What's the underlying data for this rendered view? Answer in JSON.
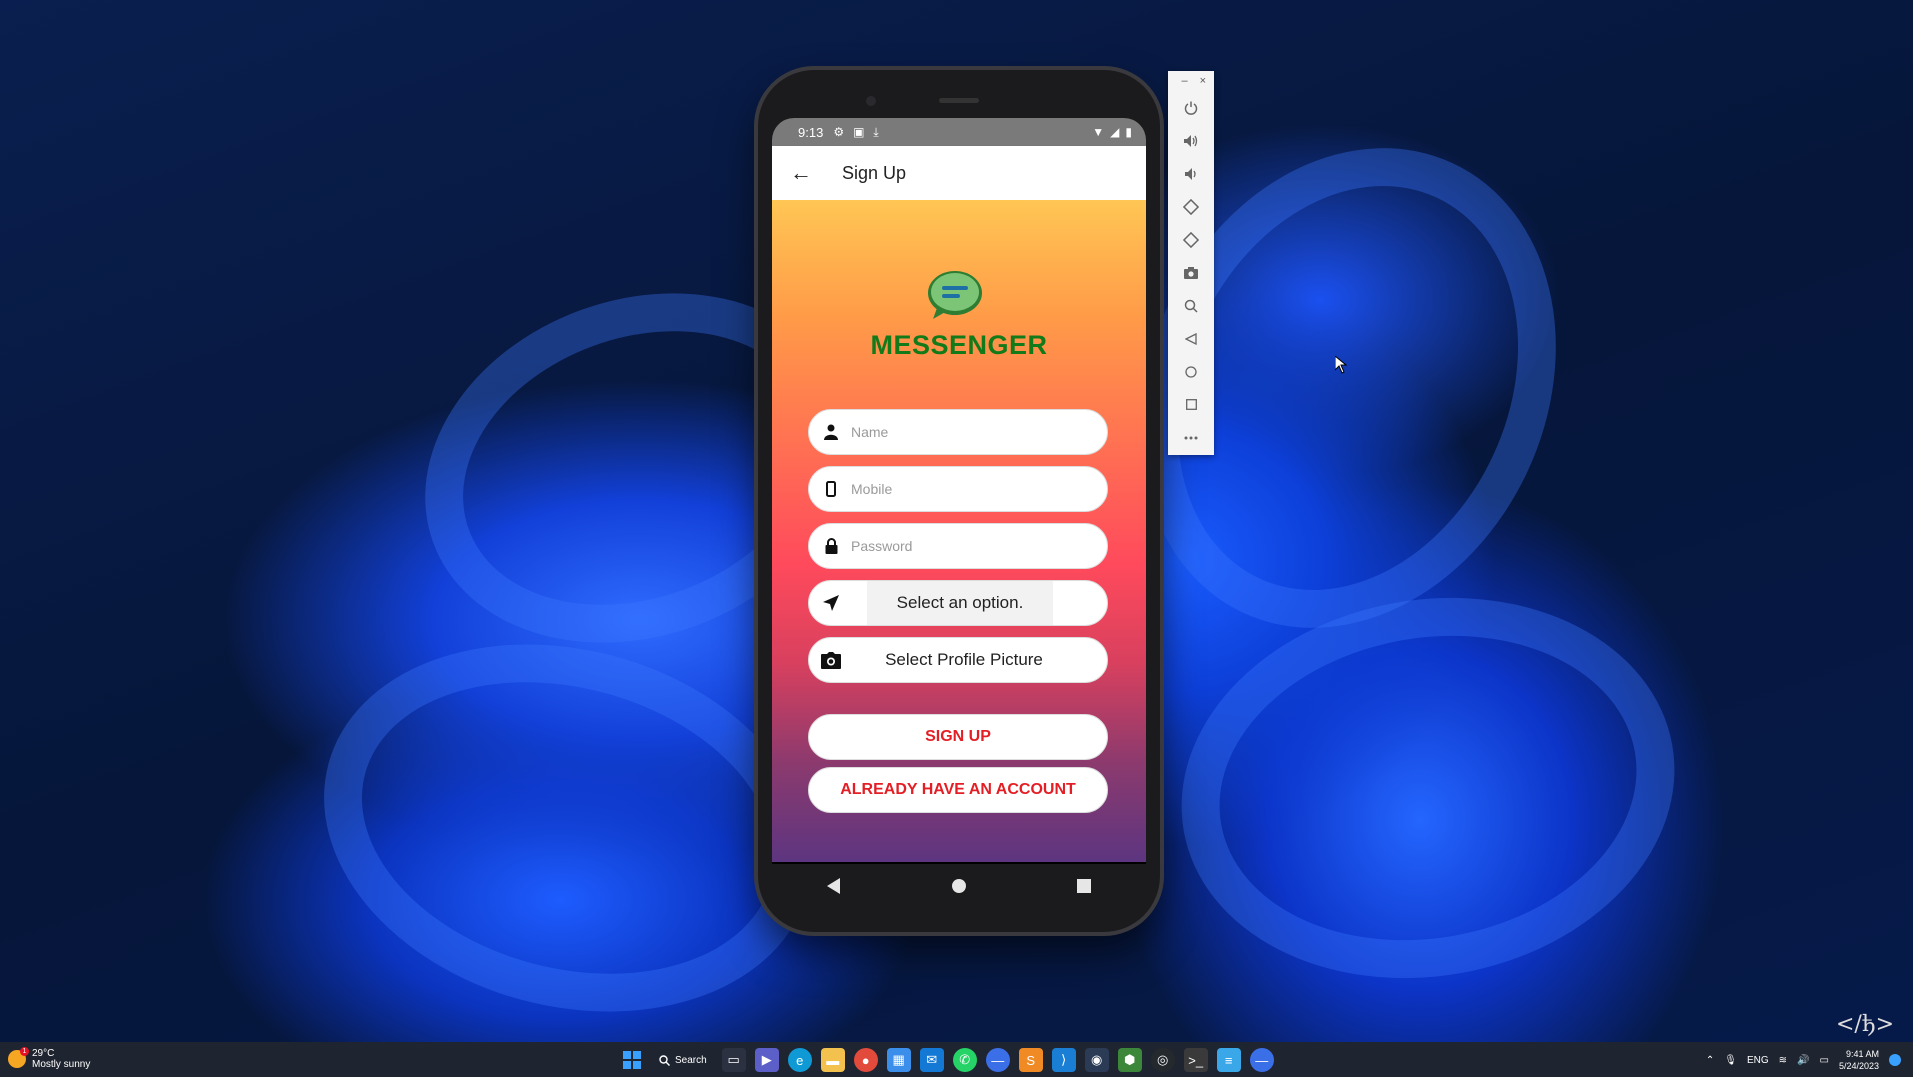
{
  "phone": {
    "status_time": "9:13",
    "appbar_title": "Sign Up",
    "brand_name": "MESSENGER",
    "form": {
      "name_placeholder": "Name",
      "mobile_placeholder": "Mobile",
      "password_placeholder": "Password",
      "select_option_label": "Select an option.",
      "profile_picture_label": "Select Profile Picture"
    },
    "signup_label": "SIGN UP",
    "have_account_label": "ALREADY HAVE AN ACCOUNT",
    "colors": {
      "brand_green": "#137a1a",
      "button_red": "#e31e24",
      "gradient_top": "#ffc654",
      "gradient_bottom": "#5d3580"
    }
  },
  "emulator_toolbar": {
    "minimize": "–",
    "close": "×",
    "buttons": [
      "power-icon",
      "volume-up-icon",
      "volume-down-icon",
      "rotate-left-icon",
      "rotate-right-icon",
      "camera-icon",
      "zoom-icon",
      "back-icon",
      "home-icon",
      "overview-icon",
      "more-icon"
    ]
  },
  "watermark": "</ђ>",
  "taskbar": {
    "weather_temp": "29°C",
    "weather_desc": "Mostly sunny",
    "weather_badge": "1",
    "search_label": "Search",
    "language": "ENG",
    "time": "9:41 AM",
    "date": "5/24/2023"
  }
}
